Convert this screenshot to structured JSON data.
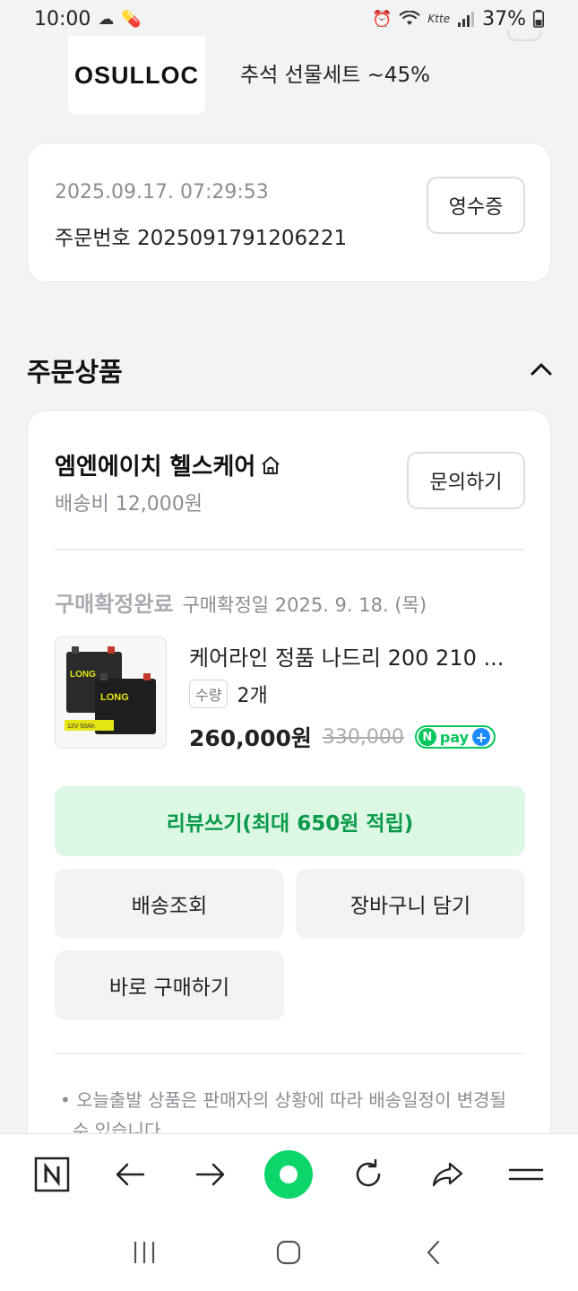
{
  "status_bar": {
    "time": "10:00",
    "battery": "37%",
    "network": "Ktte"
  },
  "banner": {
    "logo": "OSULLOC",
    "text": "추석 선물세트 ~45%"
  },
  "order": {
    "datetime": "2025.09.17. 07:29:53",
    "number": "주문번호 2025091791206221",
    "receipt_label": "영수증"
  },
  "section": {
    "title": "주문상품"
  },
  "seller": {
    "name": "엠엔에이치 헬스케어",
    "shipping": "배송비 12,000원",
    "inquiry_label": "문의하기"
  },
  "item": {
    "status": "구매확정완료",
    "confirm_date": "구매확정일 2025. 9. 18. (목)",
    "name": "케어라인 정품 나드리 200 210 ...",
    "qty_label": "수량",
    "qty": "2개",
    "price": "260,000원",
    "original_price": "330,000",
    "npay_label": "pay",
    "thumb_brand": "LONG",
    "thumb_spec": "12V 50Ah"
  },
  "actions": {
    "review": "리뷰쓰기(최대 650원 적립)",
    "track": "배송조회",
    "cart": "장바구니 담기",
    "buy_now": "바로 구매하기"
  },
  "notice": {
    "text": "오늘출발 상품은 판매자의 상황에 따라 배송일정이 변경될 수 있습니다."
  },
  "colors": {
    "accent_green": "#03c75a",
    "review_bg": "#dcf8e5",
    "review_text": "#0a9a48"
  }
}
